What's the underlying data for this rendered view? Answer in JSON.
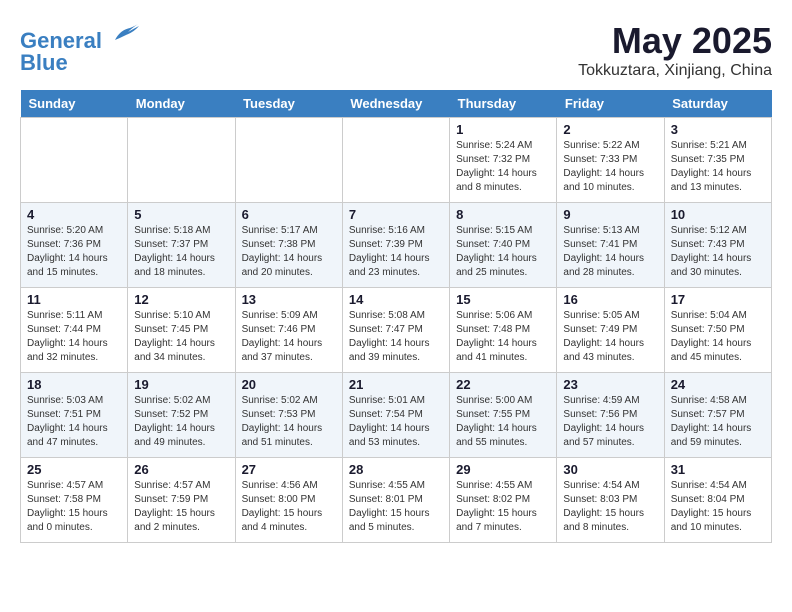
{
  "header": {
    "logo_line1": "General",
    "logo_line2": "Blue",
    "month_year": "May 2025",
    "location": "Tokkuztara, Xinjiang, China"
  },
  "weekdays": [
    "Sunday",
    "Monday",
    "Tuesday",
    "Wednesday",
    "Thursday",
    "Friday",
    "Saturday"
  ],
  "weeks": [
    [
      {
        "day": "",
        "info": ""
      },
      {
        "day": "",
        "info": ""
      },
      {
        "day": "",
        "info": ""
      },
      {
        "day": "",
        "info": ""
      },
      {
        "day": "1",
        "info": "Sunrise: 5:24 AM\nSunset: 7:32 PM\nDaylight: 14 hours\nand 8 minutes."
      },
      {
        "day": "2",
        "info": "Sunrise: 5:22 AM\nSunset: 7:33 PM\nDaylight: 14 hours\nand 10 minutes."
      },
      {
        "day": "3",
        "info": "Sunrise: 5:21 AM\nSunset: 7:35 PM\nDaylight: 14 hours\nand 13 minutes."
      }
    ],
    [
      {
        "day": "4",
        "info": "Sunrise: 5:20 AM\nSunset: 7:36 PM\nDaylight: 14 hours\nand 15 minutes."
      },
      {
        "day": "5",
        "info": "Sunrise: 5:18 AM\nSunset: 7:37 PM\nDaylight: 14 hours\nand 18 minutes."
      },
      {
        "day": "6",
        "info": "Sunrise: 5:17 AM\nSunset: 7:38 PM\nDaylight: 14 hours\nand 20 minutes."
      },
      {
        "day": "7",
        "info": "Sunrise: 5:16 AM\nSunset: 7:39 PM\nDaylight: 14 hours\nand 23 minutes."
      },
      {
        "day": "8",
        "info": "Sunrise: 5:15 AM\nSunset: 7:40 PM\nDaylight: 14 hours\nand 25 minutes."
      },
      {
        "day": "9",
        "info": "Sunrise: 5:13 AM\nSunset: 7:41 PM\nDaylight: 14 hours\nand 28 minutes."
      },
      {
        "day": "10",
        "info": "Sunrise: 5:12 AM\nSunset: 7:43 PM\nDaylight: 14 hours\nand 30 minutes."
      }
    ],
    [
      {
        "day": "11",
        "info": "Sunrise: 5:11 AM\nSunset: 7:44 PM\nDaylight: 14 hours\nand 32 minutes."
      },
      {
        "day": "12",
        "info": "Sunrise: 5:10 AM\nSunset: 7:45 PM\nDaylight: 14 hours\nand 34 minutes."
      },
      {
        "day": "13",
        "info": "Sunrise: 5:09 AM\nSunset: 7:46 PM\nDaylight: 14 hours\nand 37 minutes."
      },
      {
        "day": "14",
        "info": "Sunrise: 5:08 AM\nSunset: 7:47 PM\nDaylight: 14 hours\nand 39 minutes."
      },
      {
        "day": "15",
        "info": "Sunrise: 5:06 AM\nSunset: 7:48 PM\nDaylight: 14 hours\nand 41 minutes."
      },
      {
        "day": "16",
        "info": "Sunrise: 5:05 AM\nSunset: 7:49 PM\nDaylight: 14 hours\nand 43 minutes."
      },
      {
        "day": "17",
        "info": "Sunrise: 5:04 AM\nSunset: 7:50 PM\nDaylight: 14 hours\nand 45 minutes."
      }
    ],
    [
      {
        "day": "18",
        "info": "Sunrise: 5:03 AM\nSunset: 7:51 PM\nDaylight: 14 hours\nand 47 minutes."
      },
      {
        "day": "19",
        "info": "Sunrise: 5:02 AM\nSunset: 7:52 PM\nDaylight: 14 hours\nand 49 minutes."
      },
      {
        "day": "20",
        "info": "Sunrise: 5:02 AM\nSunset: 7:53 PM\nDaylight: 14 hours\nand 51 minutes."
      },
      {
        "day": "21",
        "info": "Sunrise: 5:01 AM\nSunset: 7:54 PM\nDaylight: 14 hours\nand 53 minutes."
      },
      {
        "day": "22",
        "info": "Sunrise: 5:00 AM\nSunset: 7:55 PM\nDaylight: 14 hours\nand 55 minutes."
      },
      {
        "day": "23",
        "info": "Sunrise: 4:59 AM\nSunset: 7:56 PM\nDaylight: 14 hours\nand 57 minutes."
      },
      {
        "day": "24",
        "info": "Sunrise: 4:58 AM\nSunset: 7:57 PM\nDaylight: 14 hours\nand 59 minutes."
      }
    ],
    [
      {
        "day": "25",
        "info": "Sunrise: 4:57 AM\nSunset: 7:58 PM\nDaylight: 15 hours\nand 0 minutes."
      },
      {
        "day": "26",
        "info": "Sunrise: 4:57 AM\nSunset: 7:59 PM\nDaylight: 15 hours\nand 2 minutes."
      },
      {
        "day": "27",
        "info": "Sunrise: 4:56 AM\nSunset: 8:00 PM\nDaylight: 15 hours\nand 4 minutes."
      },
      {
        "day": "28",
        "info": "Sunrise: 4:55 AM\nSunset: 8:01 PM\nDaylight: 15 hours\nand 5 minutes."
      },
      {
        "day": "29",
        "info": "Sunrise: 4:55 AM\nSunset: 8:02 PM\nDaylight: 15 hours\nand 7 minutes."
      },
      {
        "day": "30",
        "info": "Sunrise: 4:54 AM\nSunset: 8:03 PM\nDaylight: 15 hours\nand 8 minutes."
      },
      {
        "day": "31",
        "info": "Sunrise: 4:54 AM\nSunset: 8:04 PM\nDaylight: 15 hours\nand 10 minutes."
      }
    ]
  ]
}
